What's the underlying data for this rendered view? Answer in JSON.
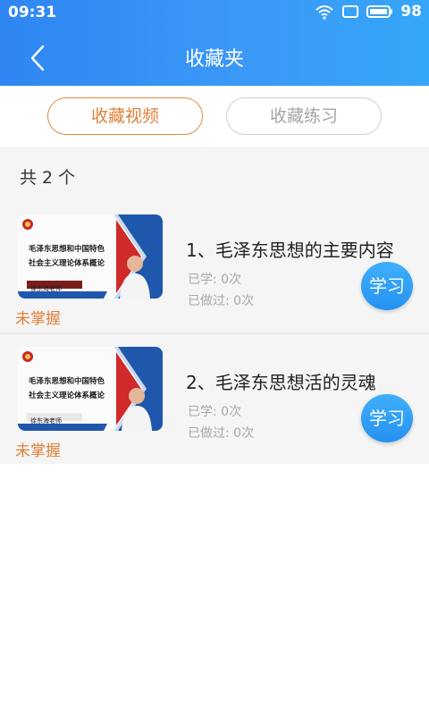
{
  "status_bar": {
    "time": "09:31",
    "battery": "98"
  },
  "nav": {
    "title": "收藏夹"
  },
  "tabs": [
    {
      "label": "收藏视频",
      "active": true
    },
    {
      "label": "收藏练习",
      "active": false
    }
  ],
  "list": {
    "count_text": "共 2 个",
    "items": [
      {
        "title": "1、毛泽东思想的主要内容",
        "learned": "已学: 0次",
        "done": "已做过: 0次",
        "button": "学习",
        "status": "未掌握",
        "thumb": {
          "line1": "毛泽东思想和中国特色",
          "line2": "社会主义理论体系概论",
          "teacher": "徐东海老师"
        }
      },
      {
        "title": "2、毛泽东思想活的灵魂",
        "learned": "已学: 0次",
        "done": "已做过: 0次",
        "button": "学习",
        "status": "未掌握",
        "thumb": {
          "line1": "毛泽东思想和中国特色",
          "line2": "社会主义理论体系概论",
          "teacher": "徐东海老师"
        }
      }
    ]
  },
  "colors": {
    "header_start": "#2f86f2",
    "header_end": "#35a6f7",
    "accent_orange": "#e07f35",
    "button_blue": "#2591f1"
  }
}
